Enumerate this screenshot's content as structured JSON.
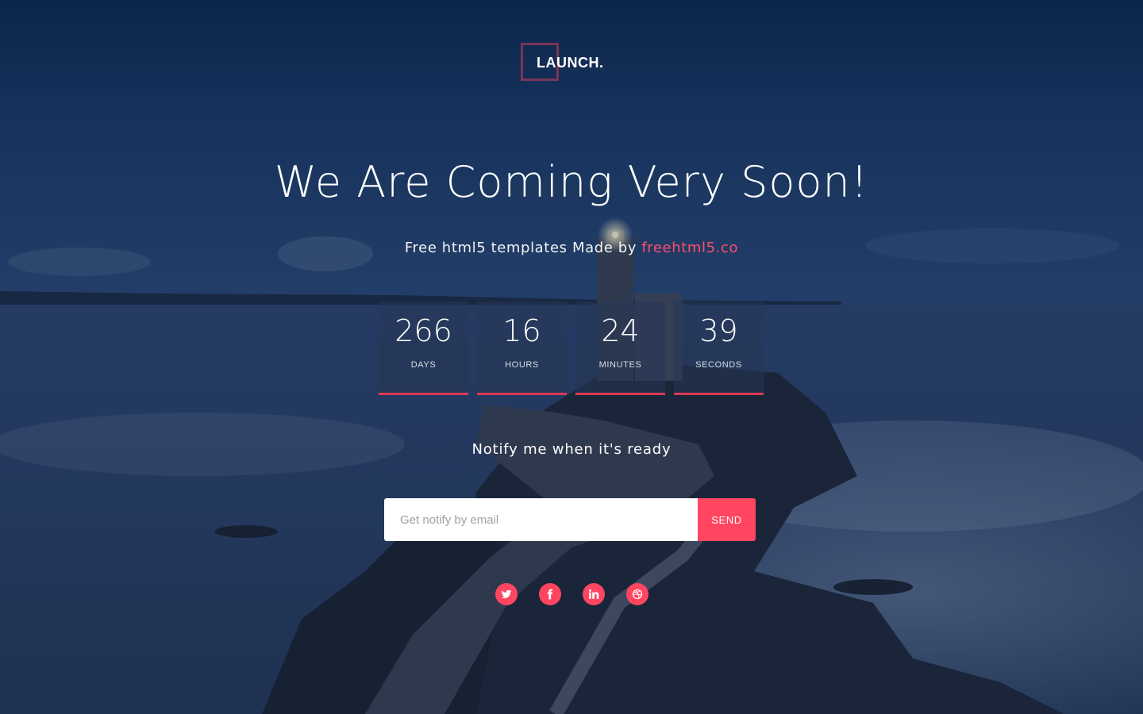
{
  "brand": {
    "logo_text": "LAUNCH."
  },
  "hero": {
    "headline": "We Are Coming Very Soon!",
    "subline_prefix": "Free html5 templates Made by",
    "subline_link": "freehtml5.co"
  },
  "countdown": [
    {
      "value": "266",
      "label": "DAYS"
    },
    {
      "value": "16",
      "label": "HOURS"
    },
    {
      "value": "24",
      "label": "MINUTES"
    },
    {
      "value": "39",
      "label": "SECONDS"
    }
  ],
  "notify": {
    "title": "Notify me when it's ready",
    "email_placeholder": "Get notify by email",
    "email_value": "",
    "send_label": "SEND"
  },
  "social": [
    {
      "icon": "twitter-icon"
    },
    {
      "icon": "facebook-icon"
    },
    {
      "icon": "linkedin-icon"
    },
    {
      "icon": "dribbble-icon"
    }
  ],
  "colors": {
    "accent": "#ff4560",
    "link": "#ff4d6a",
    "logo_frame": "#d23c5a"
  }
}
